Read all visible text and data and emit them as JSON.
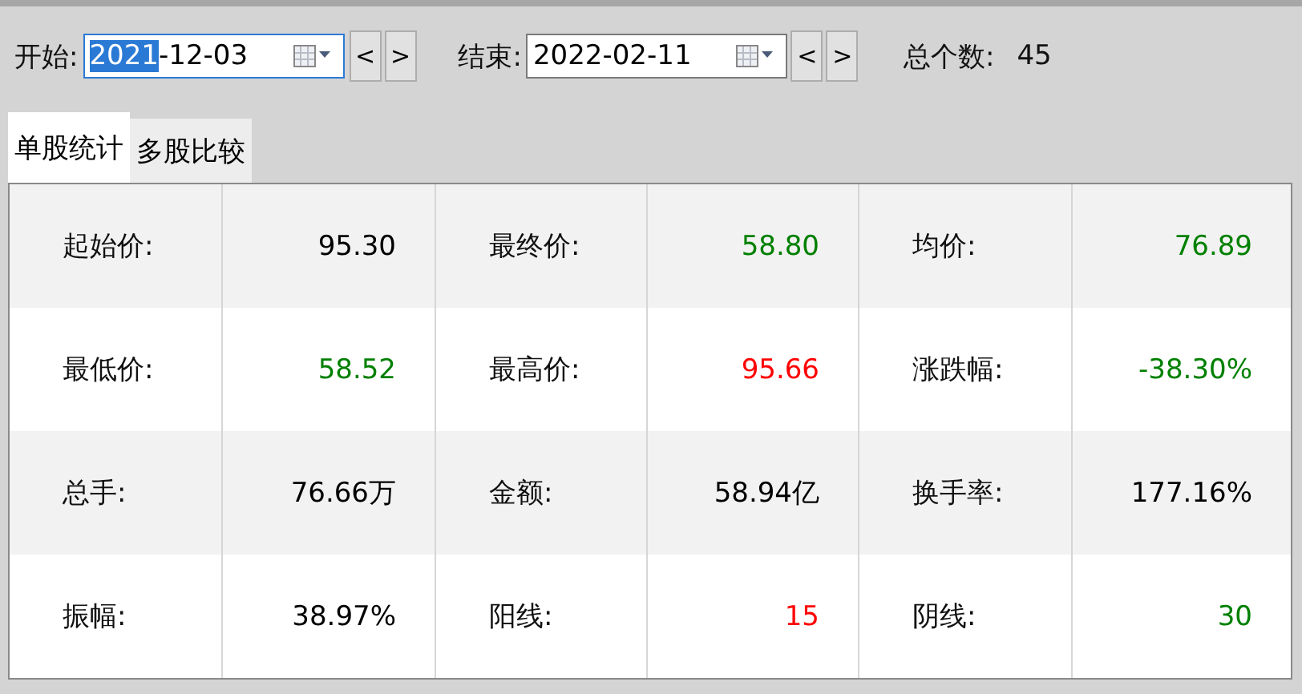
{
  "toolbar": {
    "start_label": "开始:",
    "start_date": {
      "focused": true,
      "parts": [
        {
          "text": "2021",
          "selected": true
        },
        {
          "text": "-12-03",
          "selected": false
        }
      ]
    },
    "end_label": "结束:",
    "end_date": {
      "focused": false,
      "parts": [
        {
          "text": "2022-02-11",
          "selected": false
        }
      ]
    },
    "prev": "<",
    "next": ">",
    "count_label": "总个数:",
    "count": "45"
  },
  "tabs": [
    {
      "label": "单股统计",
      "selected": true
    },
    {
      "label": "多股比较",
      "selected": false
    }
  ],
  "rows": [
    [
      {
        "label": "起始价:",
        "value": "95.30",
        "color": "#000000"
      },
      {
        "label": "最终价:",
        "value": "58.80",
        "color": "#008000"
      },
      {
        "label": "均价:",
        "value": "76.89",
        "color": "#008000"
      }
    ],
    [
      {
        "label": "最低价:",
        "value": "58.52",
        "color": "#008000"
      },
      {
        "label": "最高价:",
        "value": "95.66",
        "color": "#ff0000"
      },
      {
        "label": "涨跌幅:",
        "value": "-38.30%",
        "color": "#008000"
      }
    ],
    [
      {
        "label": "总手:",
        "value": "76.66万",
        "color": "#000000"
      },
      {
        "label": "金额:",
        "value": "58.94亿",
        "color": "#000000"
      },
      {
        "label": "换手率:",
        "value": "177.16%",
        "color": "#000000"
      }
    ],
    [
      {
        "label": "振幅:",
        "value": "38.97%",
        "color": "#000000"
      },
      {
        "label": "阳线:",
        "value": "15",
        "color": "#ff0000"
      },
      {
        "label": "阴线:",
        "value": "30",
        "color": "#008000"
      }
    ]
  ]
}
